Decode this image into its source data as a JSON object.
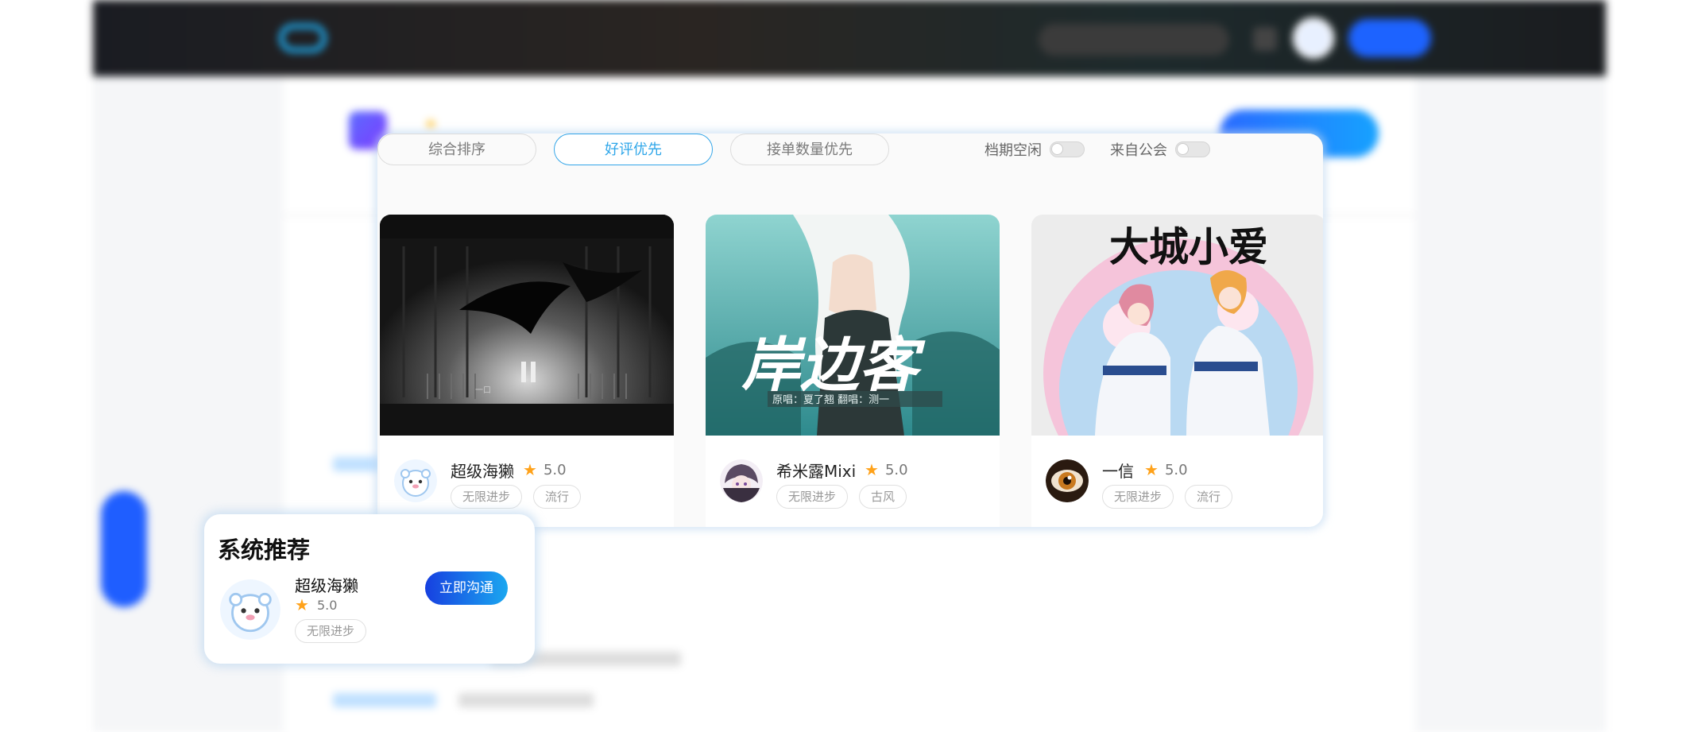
{
  "filters": {
    "tabs": [
      {
        "label": "综合排序",
        "active": false
      },
      {
        "label": "好评优先",
        "active": true
      },
      {
        "label": "接单数量优先",
        "active": false
      }
    ],
    "toggles": [
      {
        "label": "档期空闲",
        "on": false
      },
      {
        "label": "来自公会",
        "on": false
      }
    ]
  },
  "cards": [
    {
      "name": "超级海獭",
      "rating": "5.0",
      "tags": [
        "无限进步",
        "流行"
      ],
      "avatar_icon": "otter-avatar-icon",
      "cover_caption": "一口"
    },
    {
      "name": "希米露Mixi",
      "rating": "5.0",
      "tags": [
        "无限进步",
        "古风"
      ],
      "avatar_icon": "anime-girl-avatar-icon",
      "cover_title": "岸边客",
      "cover_caption": "原唱：夏了翘   翻唱：测一"
    },
    {
      "name": "一信",
      "rating": "5.0",
      "tags": [
        "无限进步",
        "流行"
      ],
      "avatar_icon": "eye-avatar-icon",
      "cover_title": "大城小爱"
    }
  ],
  "recommend": {
    "title": "系统推荐",
    "name": "超级海獭",
    "rating": "5.0",
    "tag": "无限进步",
    "button_label": "立即沟通"
  },
  "colors": {
    "accent": "#2ea6e9",
    "star": "#ffa21a",
    "button_gradient_start": "#1740e0",
    "button_gradient_end": "#1aa7f0"
  }
}
